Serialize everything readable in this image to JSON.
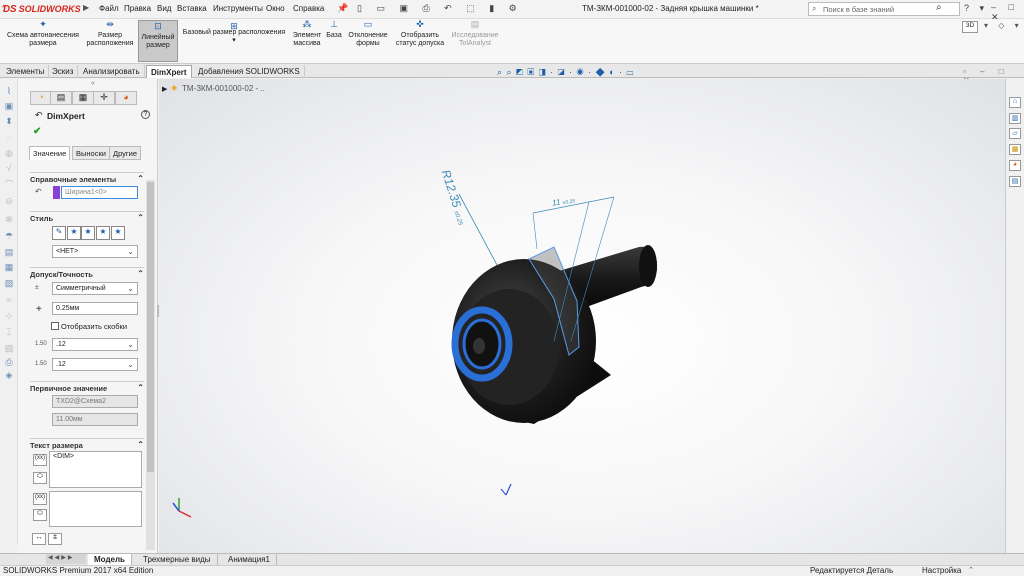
{
  "app": {
    "logo": "SOLIDWORKS",
    "doc_title": "ТМ-ЗКМ-001000-02 - Задняя крышка машинки *",
    "menu": [
      "Файл",
      "Правка",
      "Вид",
      "Вставка",
      "Инструменты",
      "Окно",
      "Справка"
    ],
    "kb_search_placeholder": "Поиск в базе знаний"
  },
  "commands": [
    {
      "label1": "Схема автонанесения",
      "label2": "размера",
      "icon": "auto-dimension-icon"
    },
    {
      "label1": "Размер",
      "label2": "расположения",
      "icon": "location-dimension-icon"
    },
    {
      "label1": "Линейный",
      "label2": "размер",
      "icon": "linear-dimension-icon"
    },
    {
      "label1": "Базовый размер расположения",
      "label2": "",
      "icon": "basic-location-icon"
    },
    {
      "label1": "Элемент",
      "label2": "массива",
      "icon": "pattern-feature-icon"
    },
    {
      "label1": "База",
      "label2": "",
      "icon": "datum-icon"
    },
    {
      "label1": "Отклонение",
      "label2": "формы",
      "icon": "geometric-tolerance-icon"
    },
    {
      "label1": "Отобразить",
      "label2": "статус допуска",
      "icon": "tolerance-status-icon"
    },
    {
      "label1": "Исследование",
      "label2": "TolAnalyst",
      "icon": "tolanalyst-icon"
    }
  ],
  "cm_tabs": [
    "Элементы",
    "Эскиз",
    "Анализировать",
    "DimXpert",
    "Добавления SOLIDWORKS"
  ],
  "panel": {
    "title": "DimXpert",
    "subtabs": [
      "Значение",
      "Выноски",
      "Другие"
    ],
    "sections": {
      "refs": "Справочные элементы",
      "style": "Стиль",
      "tolerance": "Допуск/Точность",
      "primary": "Первичное значение",
      "dimtext": "Текст размера"
    },
    "ref_value": "Ширина1<0>",
    "style_select": "<НЕТ>",
    "tol_type": "Симметричный",
    "tol_value": "0.25мм",
    "show_brackets": "Отобразить скобки",
    "precision1": ".12",
    "precision2": ".12",
    "primary_name": "TXD2@Схема2",
    "primary_value": "11.00мм",
    "dim_text": "<DIM>"
  },
  "tree": {
    "root": "ТМ-ЗКМ-001000-02 - .."
  },
  "model_annotations": {
    "radius": "R12.35",
    "radius_tol": "±0.25",
    "linear": "11",
    "linear_tol": "±0.25"
  },
  "bottom_tabs": [
    "Модель",
    "Трехмерные виды",
    "Анимация1"
  ],
  "status": {
    "edition": "SOLIDWORKS Premium 2017 x64 Edition",
    "editing": "Редактируется Деталь",
    "settings": "Настройка"
  },
  "colors": {
    "accent_blue": "#1d5fa8",
    "model_blue": "#2a6fd6",
    "dim_color": "#3d8bb5"
  }
}
